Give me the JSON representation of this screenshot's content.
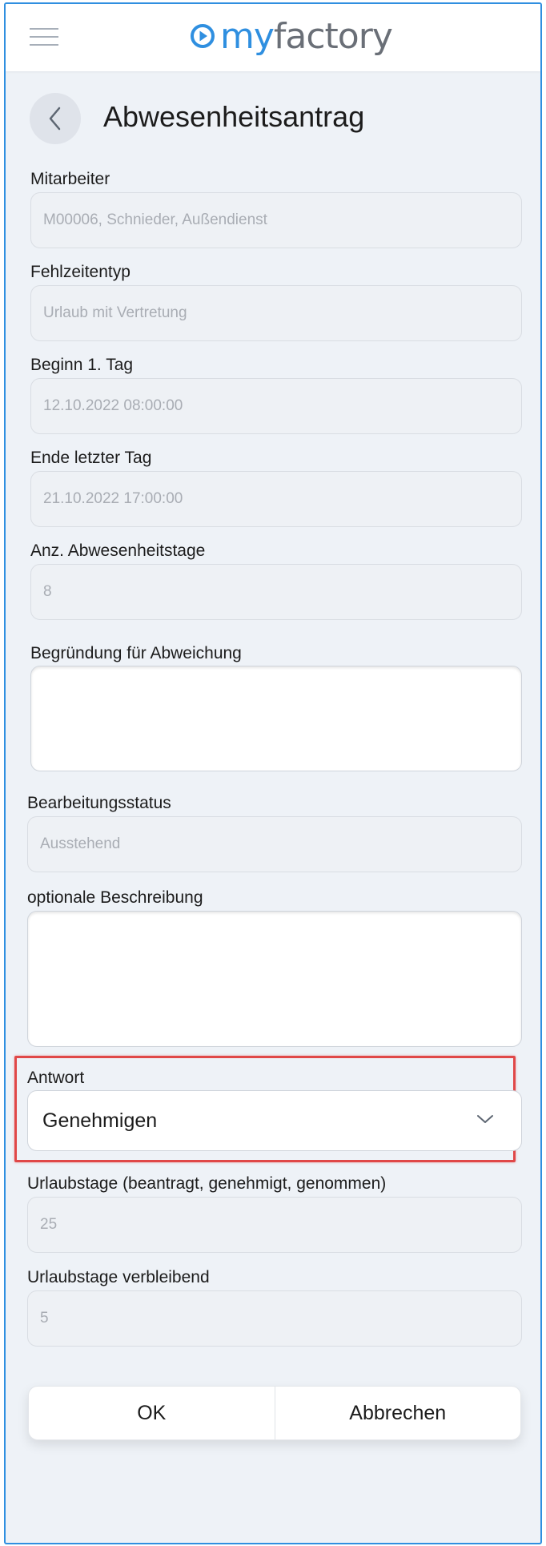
{
  "header": {
    "logo_my": "my",
    "logo_factory": "factory",
    "menu_icon": "hamburger-icon",
    "logo_icon": "play-circle-icon"
  },
  "page": {
    "title": "Abwesenheitsantrag",
    "back_icon": "chevron-left-icon"
  },
  "form": {
    "mitarbeiter": {
      "label": "Mitarbeiter",
      "value": "M00006, Schnieder, Außendienst"
    },
    "fehlzeitentyp": {
      "label": "Fehlzeitentyp",
      "value": "Urlaub mit Vertretung"
    },
    "beginn": {
      "label": "Beginn 1. Tag",
      "value": "12.10.2022 08:00:00"
    },
    "ende": {
      "label": "Ende letzter Tag",
      "value": "21.10.2022 17:00:00"
    },
    "abwesenheitstage": {
      "label": "Anz. Abwesenheitstage",
      "value": "8"
    },
    "begruendung": {
      "label": "Begründung für Abweichung",
      "value": ""
    },
    "bearbeitungsstatus": {
      "label": "Bearbeitungsstatus",
      "value": "Ausstehend"
    },
    "beschreibung": {
      "label": "optionale Beschreibung",
      "value": ""
    },
    "antwort": {
      "label": "Antwort",
      "value": "Genehmigen"
    },
    "urlaubstage": {
      "label": "Urlaubstage (beantragt, genehmigt, genommen)",
      "value": "25"
    },
    "verbleibend": {
      "label": "Urlaubstage verbleibend",
      "value": "5"
    }
  },
  "buttons": {
    "ok": "OK",
    "cancel": "Abbrechen"
  },
  "colors": {
    "accent": "#2f8fe0",
    "highlight": "#e04848",
    "background": "#eef2f7"
  }
}
